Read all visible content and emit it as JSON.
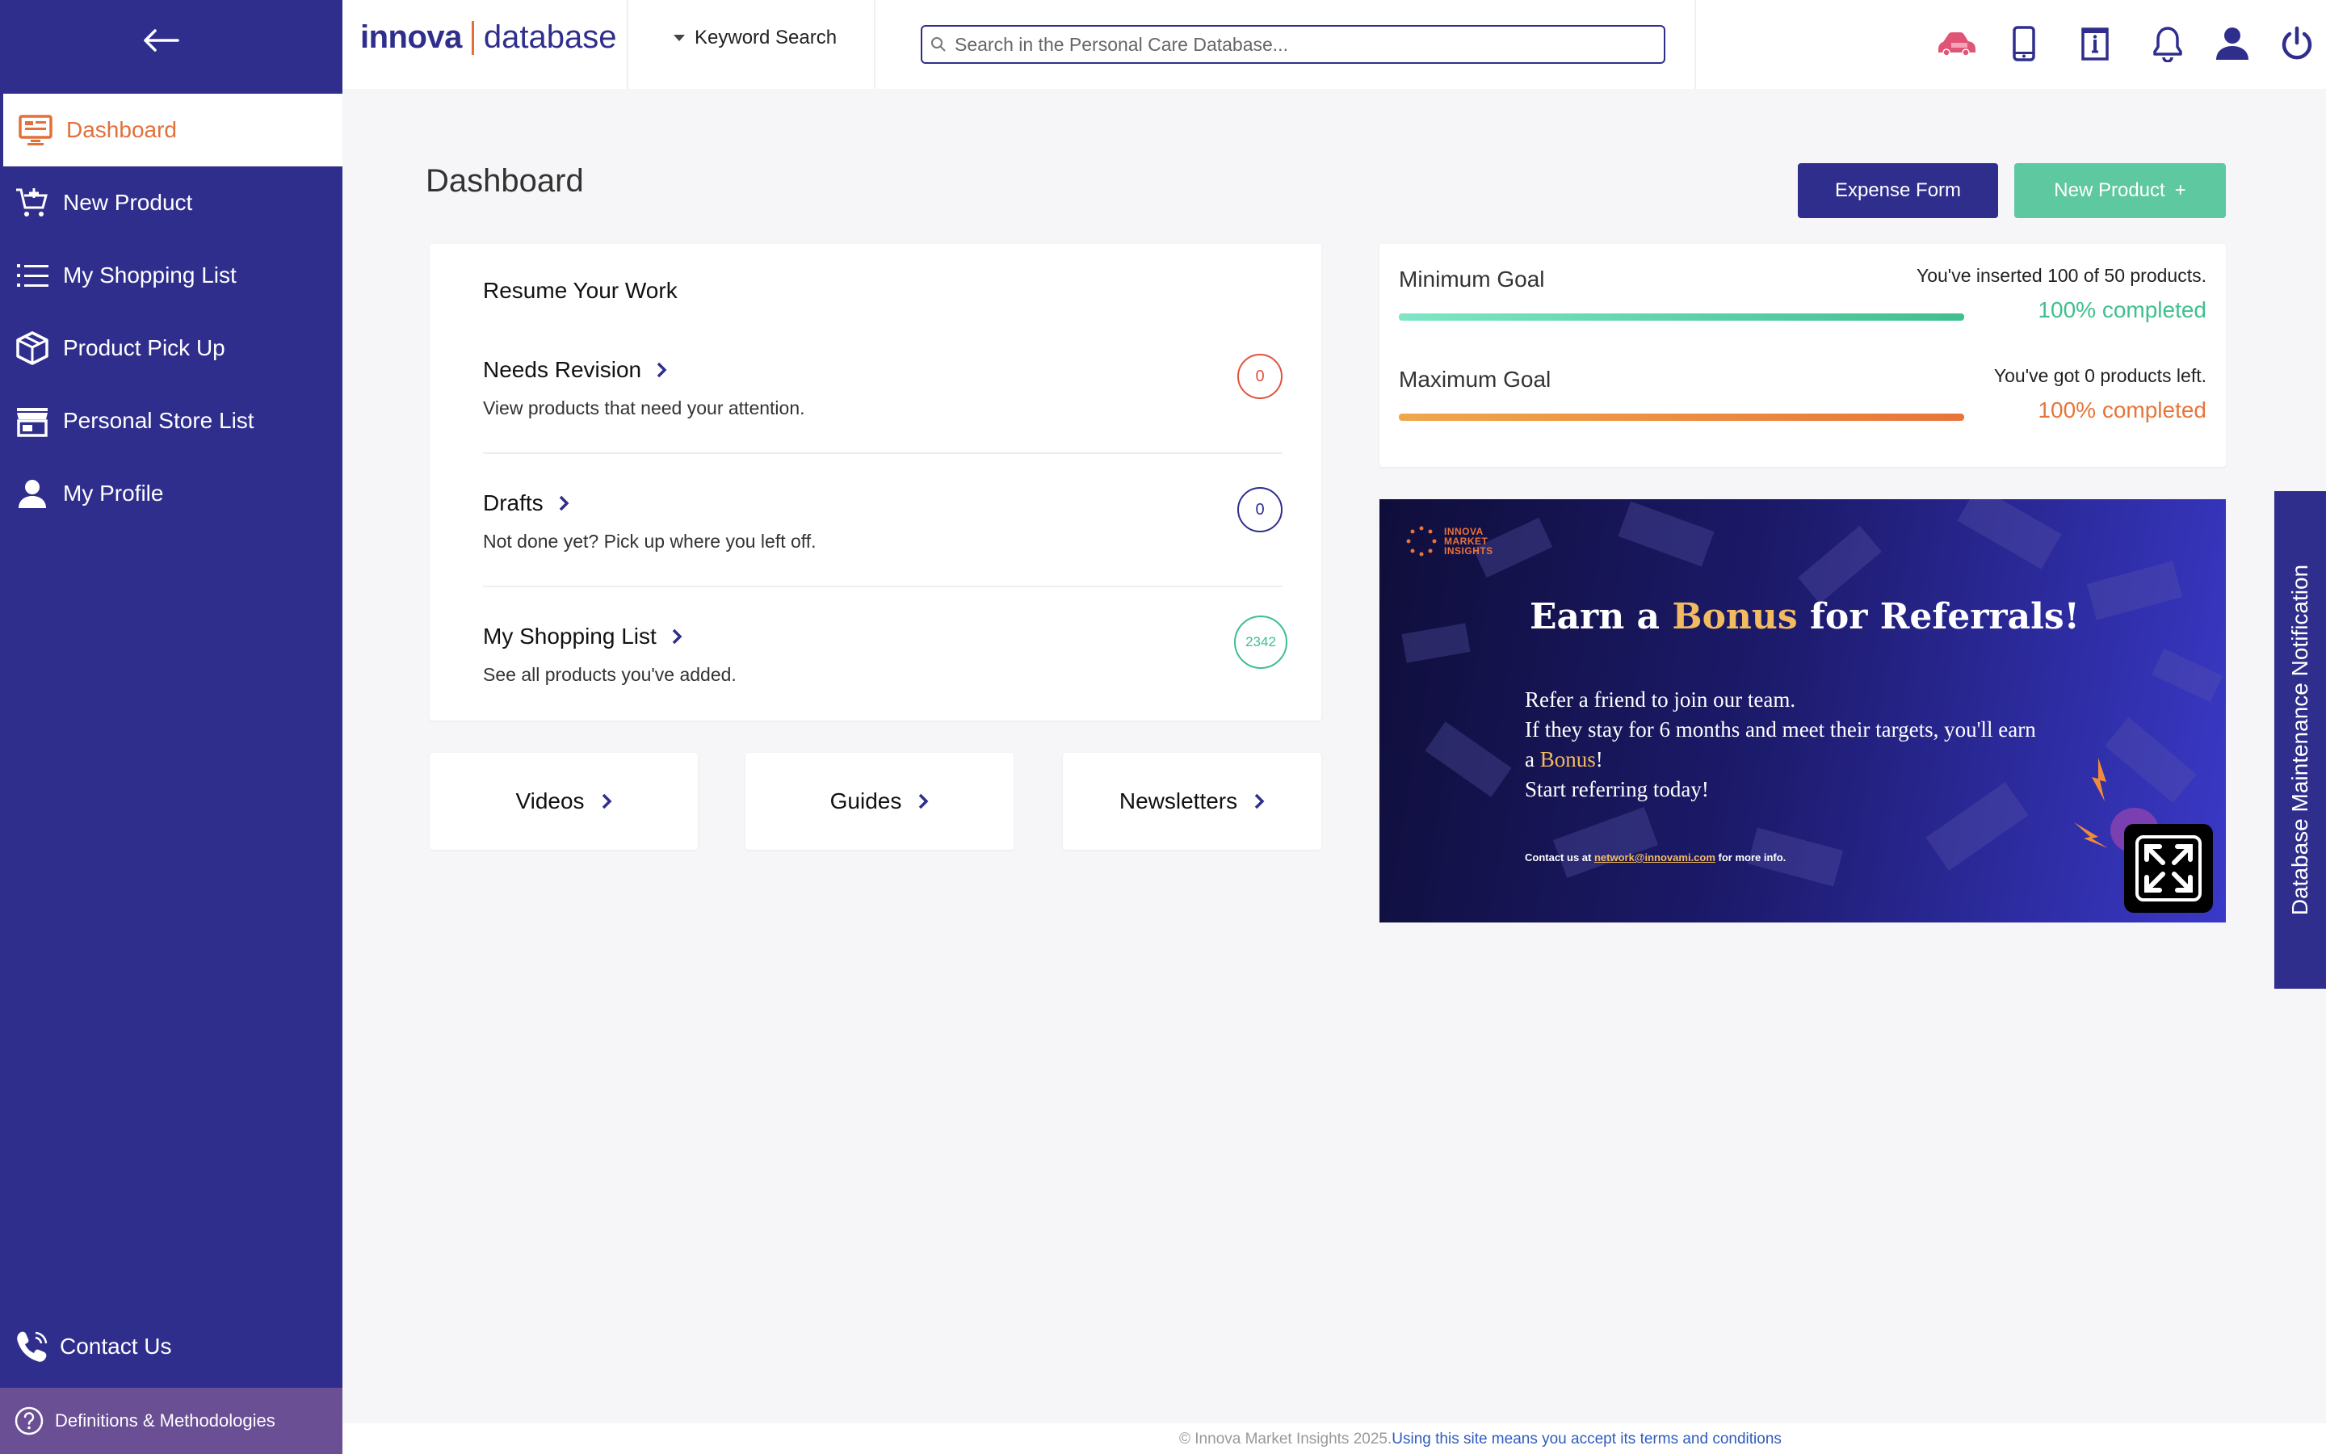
{
  "sidebar": {
    "items": [
      {
        "label": "Dashboard",
        "icon": "monitor-icon"
      },
      {
        "label": "New Product",
        "icon": "cart-plus-icon"
      },
      {
        "label": "My Shopping List",
        "icon": "list-icon"
      },
      {
        "label": "Product Pick Up",
        "icon": "box-icon"
      },
      {
        "label": "Personal Store List",
        "icon": "store-icon"
      },
      {
        "label": "My Profile",
        "icon": "user-icon"
      }
    ],
    "contact_label": "Contact Us",
    "definitions_label": "Definitions & Methodologies",
    "colors": {
      "background": "#2f2e8d",
      "active_text": "#e2703a",
      "definitions_bg": "#6a4f94"
    }
  },
  "header": {
    "logo_bold": "innova",
    "logo_light": "database",
    "keyword_search_label": "Keyword Search",
    "search_placeholder": "Search in the Personal Care Database..."
  },
  "main": {
    "page_title": "Dashboard",
    "expense_button": "Expense Form",
    "new_product_button": "New Product",
    "new_product_button_icon": "+",
    "resume": {
      "title": "Resume Your Work",
      "rows": [
        {
          "title": "Needs Revision",
          "desc": "View products that need your attention.",
          "count": "0",
          "color": "#e0533e"
        },
        {
          "title": "Drafts",
          "desc": "Not done yet? Pick up where you left off.",
          "count": "0",
          "color": "#2f2e8d"
        },
        {
          "title": "My Shopping List",
          "desc": "See all products you've added.",
          "count": "2342",
          "color": "#3fbf8f"
        }
      ]
    },
    "tiles": [
      {
        "label": "Videos"
      },
      {
        "label": "Guides"
      },
      {
        "label": "Newsletters"
      }
    ],
    "goals": [
      {
        "label": "Minimum Goal",
        "info": "You've inserted 100 of 50 products.",
        "pct": "100% completed",
        "progress": 1.0,
        "color": "#3fbf8f"
      },
      {
        "label": "Maximum Goal",
        "info": "You've got 0 products left.",
        "pct": "100% completed",
        "progress": 1.0,
        "color": "#e8753a"
      }
    ],
    "banner": {
      "brand_line1": "INNOVA",
      "brand_line2": "MARKET",
      "brand_line3": "INSIGHTS",
      "headline_pre": "Earn a ",
      "headline_gold": "Bonus",
      "headline_post": " for Referrals!",
      "line1": "Refer a friend to join our team.",
      "line2": "If they stay for 6 months and meet their targets, you'll earn",
      "line3_pre": "a ",
      "line3_gold": "Bonus",
      "line3_post": "!",
      "line4": "Start referring today!",
      "contact_pre": "Contact us at ",
      "contact_link": "network@innovami.com",
      "contact_post": " for more info."
    },
    "side_tab": "Database Maintenance Notification"
  },
  "footer": {
    "copyright": "© Innova Market Insights 2025.",
    "terms": "Using this site means you accept its terms and conditions"
  }
}
